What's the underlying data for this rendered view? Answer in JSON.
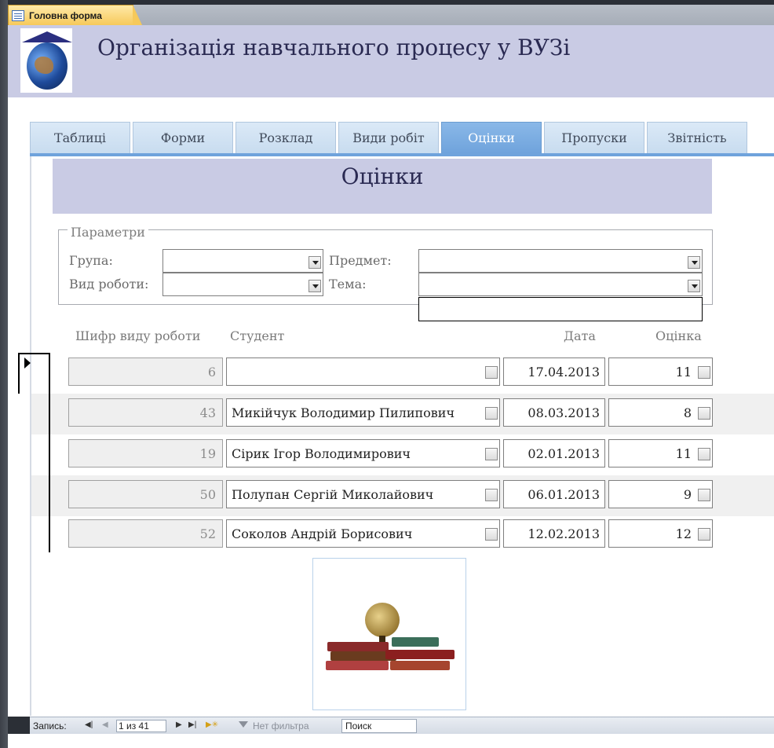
{
  "window": {
    "doc_tab_label": "Головна форма"
  },
  "header": {
    "app_title": "Організація навчального процесу у ВУЗі"
  },
  "nav_tabs": [
    {
      "label": "Таблиці",
      "active": false
    },
    {
      "label": "Форми",
      "active": false
    },
    {
      "label": "Розклад",
      "active": false
    },
    {
      "label": "Види робіт",
      "active": false
    },
    {
      "label": "Оцінки",
      "active": true
    },
    {
      "label": "Пропуски",
      "active": false
    },
    {
      "label": "Звітність",
      "active": false
    }
  ],
  "section": {
    "title": "Оцінки"
  },
  "params": {
    "legend": "Параметри",
    "group_label": "Група:",
    "group_value": "",
    "worktype_label": "Вид роботи:",
    "worktype_value": "",
    "subject_label": "Предмет:",
    "subject_value": "",
    "topic_label": "Тема:",
    "topic_value": ""
  },
  "table": {
    "headers": {
      "code": "Шифр виду роботи",
      "student": "Студент",
      "date": "Дата",
      "grade": "Оцінка"
    },
    "rows": [
      {
        "code": "6",
        "student": "",
        "date": "17.04.2013",
        "grade": "11"
      },
      {
        "code": "43",
        "student": "Микійчук Володимир Пилипович",
        "date": "08.03.2013",
        "grade": "8"
      },
      {
        "code": "19",
        "student": "Сірик Ігор Володимирович",
        "date": "02.01.2013",
        "grade": "11"
      },
      {
        "code": "50",
        "student": "Полупан Сергій Миколайович",
        "date": "06.01.2013",
        "grade": "9"
      },
      {
        "code": "52",
        "student": "Соколов Андрій Борисович",
        "date": "12.02.2013",
        "grade": "12"
      }
    ]
  },
  "statusbar": {
    "record_label": "Запись:",
    "record_value": "1 из 41",
    "filter_label": "Нет фильтра",
    "search_placeholder": "Поиск"
  },
  "colors": {
    "accent_tab": "#6fa3dc",
    "header_band": "#c9cbe4",
    "doc_tab": "#f6c95a"
  }
}
